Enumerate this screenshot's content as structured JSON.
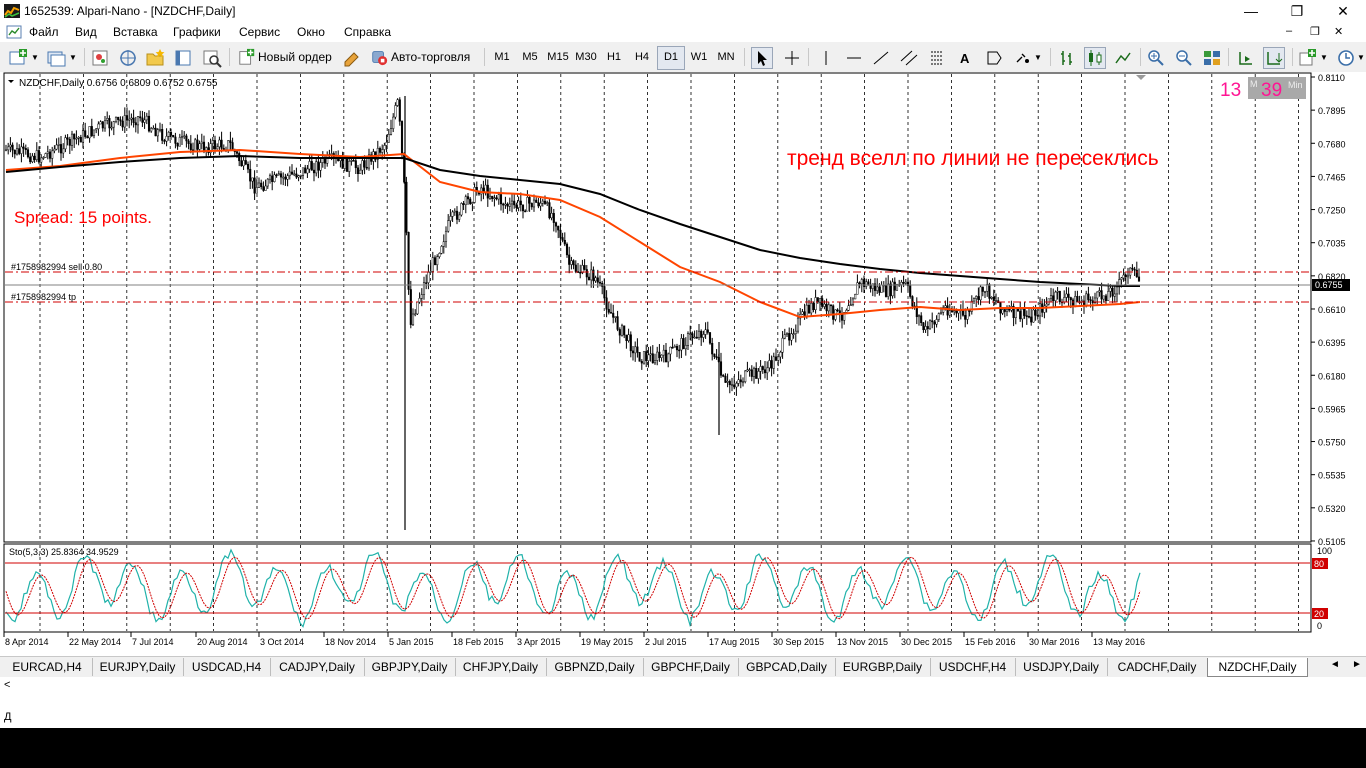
{
  "window": {
    "title": "1652539: Alpari-Nano - [NZDCHF,Daily]",
    "minimize_glyph": "—",
    "restore_glyph": "❐",
    "close_glyph": "✕"
  },
  "menu": [
    "Файл",
    "Вид",
    "Вставка",
    "Графики",
    "Сервис",
    "Окно",
    "Справка"
  ],
  "toolbar": {
    "new_order_label": "Новый ордер",
    "autotrading_label": "Авто-торговля",
    "timeframes": [
      "M1",
      "M5",
      "M15",
      "M30",
      "H1",
      "H4",
      "D1",
      "W1",
      "MN"
    ],
    "active_timeframe": "D1",
    "text_tool_label": "A"
  },
  "chart": {
    "header": "NZDCHF,Daily  0.6756 0.6809 0.6752 0.6755",
    "timer_hours": "13",
    "timer_minutes": "39",
    "timer_unit": "Min",
    "timer_prefix": "M",
    "annotation": "тренд вселл по линии не пересеклись",
    "spread_text": "Spread: 15 points.",
    "sell_order_label": "#1758982994 sell 0.80",
    "tp_label": "#1758982994 tp",
    "current_price": "0.6755",
    "price_axis": [
      "0.8110",
      "0.7895",
      "0.7680",
      "0.7465",
      "0.7250",
      "0.7035",
      "0.6820",
      "0.6610",
      "0.6395",
      "0.6180",
      "0.5965",
      "0.5750",
      "0.5535",
      "0.5320",
      "0.5105"
    ],
    "time_axis": [
      "8 Apr 2014",
      "22 May 2014",
      "7 Jul 2014",
      "20 Aug 2014",
      "3 Oct 2014",
      "18 Nov 2014",
      "5 Jan 2015",
      "18 Feb 2015",
      "3 Apr 2015",
      "19 May 2015",
      "2 Jul 2015",
      "17 Aug 2015",
      "30 Sep 2015",
      "13 Nov 2015",
      "30 Dec 2015",
      "15 Feb 2016",
      "30 Mar 2016",
      "13 May 2016"
    ],
    "stochastic_label": "Sto(5,3,3) 25.8364 34.9529",
    "stochastic_axis": [
      "100",
      "80",
      "20",
      "0"
    ],
    "colors": {
      "annotation": "#ff0000",
      "timer_hours": "#ff1493",
      "timer_box": "#a9a9a9",
      "ma_fast": "#ff4500",
      "ma_slow": "#000000",
      "level_lines": "#d00000"
    }
  },
  "tabs": [
    "EURCAD,H4",
    "EURJPY,Daily",
    "USDCAD,H4",
    "CADJPY,Daily",
    "GBPJPY,Daily",
    "CHFJPY,Daily",
    "GBPNZD,Daily",
    "GBPCHF,Daily",
    "GBPCAD,Daily",
    "EURGBP,Daily",
    "USDCHF,H4",
    "USDJPY,Daily",
    "CADCHF,Daily",
    "NZDCHF,Daily"
  ],
  "active_tab": "NZDCHF,Daily",
  "status": {
    "line1": "<",
    "line2": "Д"
  }
}
